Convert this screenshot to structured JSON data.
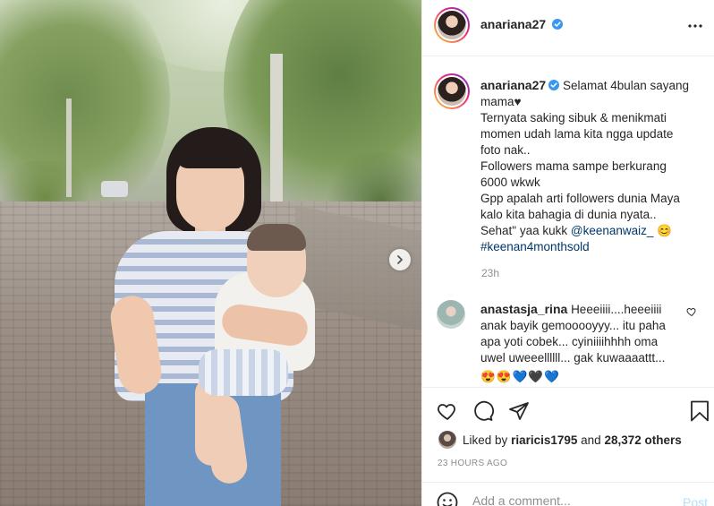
{
  "post": {
    "author": "anariana27",
    "caption_lines": [
      "Selamat 4bulan sayang",
      "mama♥",
      "Ternyata saking sibuk & menikmati",
      "momen udah lama kita ngga update",
      "foto nak..",
      "Followers mama sampe berkurang",
      "6000 wkwk",
      "Gpp apalah arti followers dunia Maya",
      "kalo kita bahagia di dunia nyata..",
      "Sehat\" yaa kukk"
    ],
    "caption_mention": "@keenanwaiz_",
    "caption_emoji": "😊",
    "caption_hashtag": "#keenan4monthsold",
    "caption_age": "23h"
  },
  "comment": {
    "author": "anastasja_rina",
    "lines": [
      "Heeeiiii....heeeiiii",
      "anak bayik gemooooyyy... itu paha",
      "apa yoti cobek... cyiniiiihhhh oma",
      "uwel uweeellllll... gak kuwaaaattt..."
    ],
    "emojis": "😍😍💙🖤💙"
  },
  "likes": {
    "prefix": "Liked by",
    "liker": "riaricis1795",
    "and_text": "and",
    "others": "28,372 others"
  },
  "post_time": "23 HOURS AGO",
  "add_comment": {
    "placeholder": "Add a comment...",
    "post_label": "Post"
  },
  "colors": {
    "verified": "#3897f0",
    "link": "#00376b",
    "muted": "#8e8e8e",
    "post_button": "#b2dffc"
  },
  "icons": [
    "chevron-right-icon",
    "verified-badge-icon",
    "more-options-icon",
    "heart-icon",
    "comment-icon",
    "share-icon",
    "bookmark-icon",
    "emoji-icon"
  ]
}
